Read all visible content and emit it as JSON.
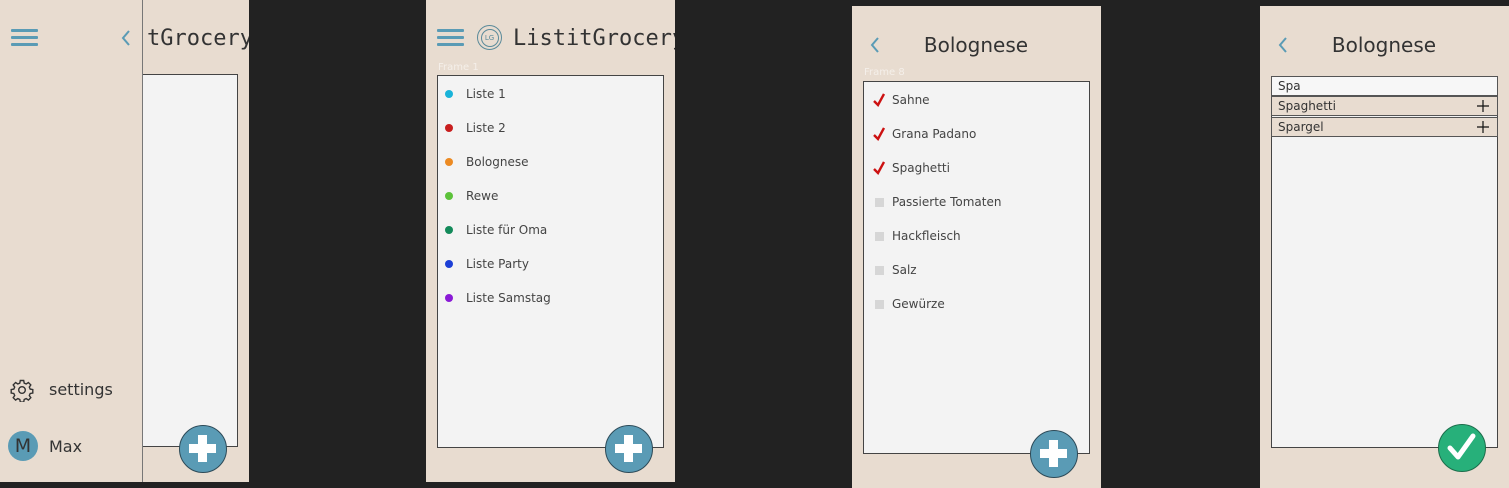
{
  "app": {
    "title": "ListitGrocery",
    "title_partial": "tGrocery",
    "logo_letter": "LG"
  },
  "drawer": {
    "settings_label": "settings",
    "user_initial": "M",
    "user_name": "Max"
  },
  "lists_screen": {
    "ghost_label": "Frame 1",
    "lists": [
      {
        "label": "Liste 1",
        "color": "#19b3d9"
      },
      {
        "label": "Liste 2",
        "color": "#c81e1e"
      },
      {
        "label": "Bolognese",
        "color": "#ec8a22"
      },
      {
        "label": "Rewe",
        "color": "#5cc23a"
      },
      {
        "label": "Liste für Oma",
        "color": "#138a5a"
      },
      {
        "label": "Liste Party",
        "color": "#1c3fd6"
      },
      {
        "label": "Liste Samstag",
        "color": "#8a1ad6"
      }
    ]
  },
  "detail_screen": {
    "title": "Bolognese",
    "ghost_label": "Frame 8",
    "items": [
      {
        "label": "Sahne",
        "checked": true
      },
      {
        "label": "Grana Padano",
        "checked": true
      },
      {
        "label": "Spaghetti",
        "checked": true
      },
      {
        "label": "Passierte Tomaten",
        "checked": false
      },
      {
        "label": "Hackfleisch",
        "checked": false
      },
      {
        "label": "Salz",
        "checked": false
      },
      {
        "label": "Gewürze",
        "checked": false
      }
    ]
  },
  "add_screen": {
    "title": "Bolognese",
    "search_value": "Spa",
    "suggestions": [
      "Spaghetti",
      "Spargel"
    ]
  },
  "colors": {
    "frame_bg": "#e8dcd0",
    "accent": "#5a9bb5",
    "confirm": "#27b07a",
    "check_red": "#cc1111"
  },
  "icons": [
    "hamburger-menu-icon",
    "chevron-left-icon",
    "gear-icon",
    "plus-icon",
    "checkmark-icon",
    "logo-icon"
  ]
}
